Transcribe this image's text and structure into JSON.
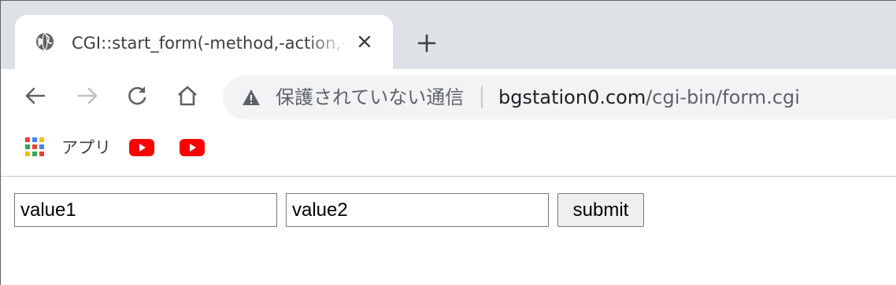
{
  "tab": {
    "title": "CGI::start_form(-method,-action,-enctype);",
    "favicon": "globe-icon",
    "close_icon": "close-icon"
  },
  "toolbar": {
    "security_label": "保護されていない通信",
    "url_host": "bgstation0.com",
    "url_path": "/cgi-bin/form.cgi",
    "icons": [
      "back-arrow-icon",
      "forward-arrow-icon",
      "reload-icon",
      "home-icon",
      "warning-icon"
    ]
  },
  "bookmarks": {
    "apps_label": "アプリ",
    "items": [
      "youtube-icon",
      "youtube-icon"
    ]
  },
  "form": {
    "field1_value": "value1",
    "field2_value": "value2",
    "submit_label": "submit"
  },
  "colors": {
    "tabstrip_bg": "#dee1e6",
    "omnibox_bg": "#f1f3f4",
    "youtube_red": "#ff0000"
  }
}
